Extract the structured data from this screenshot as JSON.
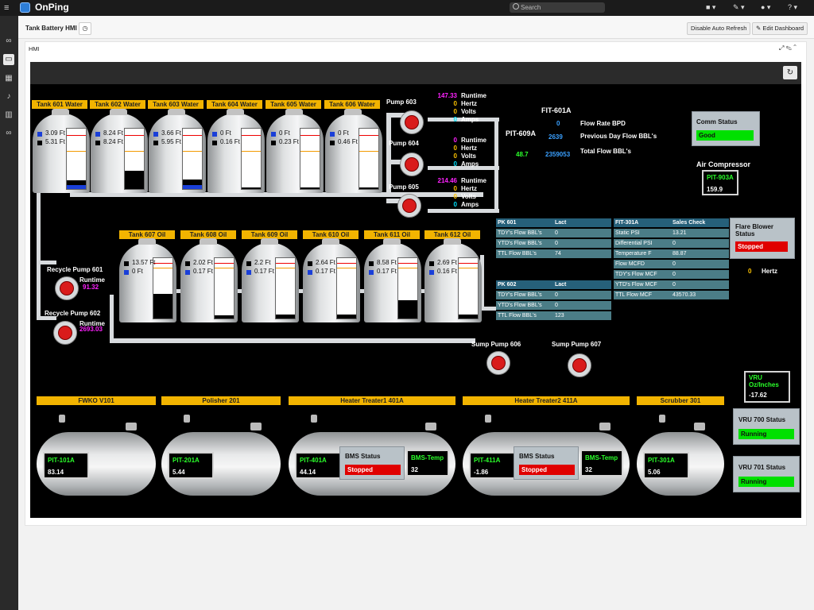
{
  "app": {
    "name": "OnPing"
  },
  "search": {
    "placeholder": "Search"
  },
  "dashboard": {
    "title": "Tank Battery HMI",
    "disable_refresh": "Disable Auto Refresh",
    "edit": "Edit Dashboard",
    "panel_title": "HMI"
  },
  "tanks_top": [
    {
      "name": "Tank 601 Water",
      "v1": "3.09 Ft",
      "v2": "5.31 Ft",
      "fill": 0.14,
      "blue": 0.07
    },
    {
      "name": "Tank 602 Water",
      "v1": "8.24 Ft",
      "v2": "8.24 Ft",
      "fill": 0.3,
      "blue": 0.0
    },
    {
      "name": "Tank 603 Water",
      "v1": "3.66 Ft",
      "v2": "5.95 Ft",
      "fill": 0.16,
      "blue": 0.06
    },
    {
      "name": "Tank 604 Water",
      "v1": "0 Ft",
      "v2": "0.16 Ft",
      "fill": 0.02,
      "blue": 0.0
    },
    {
      "name": "Tank 605 Water",
      "v1": "0 Ft",
      "v2": "0.23 Ft",
      "fill": 0.02,
      "blue": 0.0
    },
    {
      "name": "Tank 606 Water",
      "v1": "0 Ft",
      "v2": "0.46 Ft",
      "fill": 0.03,
      "blue": 0.0
    }
  ],
  "tanks_bottom": [
    {
      "name": "Tank 607 Oil",
      "v1": "13.57 Ft",
      "v2": "0 Ft",
      "fill": 0.4
    },
    {
      "name": "Tank 608 Oil",
      "v1": "2.02 Ft",
      "v2": "0.17 Ft",
      "fill": 0.05
    },
    {
      "name": "Tank 609 Oil",
      "v1": "2.2 Ft",
      "v2": "0.17 Ft",
      "fill": 0.06
    },
    {
      "name": "Tank 610 Oil",
      "v1": "2.64 Ft",
      "v2": "0.17 Ft",
      "fill": 0.06
    },
    {
      "name": "Tank 611 Oil",
      "v1": "8.58 Ft",
      "v2": "0.17 Ft",
      "fill": 0.3
    },
    {
      "name": "Tank 612 Oil",
      "v1": "2.69 Ft",
      "v2": "0.16 Ft",
      "fill": 0.07
    }
  ],
  "pumps": [
    {
      "name": "Pump 603",
      "runtime": "147.33",
      "hertz": "0",
      "volts": "0",
      "amps": "0"
    },
    {
      "name": "Pump 604",
      "runtime": "0",
      "hertz": "0",
      "volts": "0",
      "amps": "0"
    },
    {
      "name": "Pump 605",
      "runtime": "214.46",
      "hertz": "0",
      "volts": "0",
      "amps": "0"
    }
  ],
  "pump_labels": {
    "runtime": "Runtime",
    "hertz": "Hertz",
    "volts": "Volts",
    "amps": "Amps"
  },
  "recycle": [
    {
      "name": "Recycle Pump 601",
      "label": "Runtime",
      "value": "91.32"
    },
    {
      "name": "Recycle Pump 602",
      "label": "Runtime",
      "value": "2693.03"
    }
  ],
  "sump": [
    "Sump Pump 606",
    "Sump Pump 607"
  ],
  "fit601": {
    "title": "FIT-601A",
    "pit": "PIT-609A",
    "pit_value": "48.7",
    "rate_value": "0",
    "rate_label": "Flow Rate BPD",
    "prev_value": "2639",
    "prev_label": "Previous Day Flow BBL's",
    "total_value": "2359053",
    "total_label": "Total Flow BBL's"
  },
  "comm": {
    "title": "Comm Status",
    "value": "Good"
  },
  "air": {
    "title": "Air Compressor",
    "tag": "PIT-903A",
    "value": "159.9"
  },
  "flare": {
    "title": "Flare Blower Status",
    "value": "Stopped",
    "hz_value": "0",
    "hz_label": "Hertz"
  },
  "pk601": {
    "headers": [
      "PK 601",
      "Lact"
    ],
    "rows": [
      [
        "TDY's Flow BBL's",
        "0"
      ],
      [
        "YTD's Flow BBL's",
        "0"
      ],
      [
        "TTL Flow BBL's",
        "74"
      ]
    ]
  },
  "pk602": {
    "headers": [
      "PK 602",
      "Lact"
    ],
    "rows": [
      [
        "TDY's Flow BBL's",
        "0"
      ],
      [
        "YTD's Flow BBL's",
        "0"
      ],
      [
        "TTL Flow BBL's",
        "123"
      ]
    ]
  },
  "fit301": {
    "headers": [
      "FIT-301A",
      "Sales Check"
    ],
    "rows": [
      [
        "Static PSI",
        "13.21"
      ],
      [
        "Differential PSI",
        "0"
      ],
      [
        "Temperature F",
        "88.87"
      ],
      [
        "Flow MCFD",
        "0"
      ],
      [
        "TDY's Flow MCF",
        "0"
      ],
      [
        "YTD's Flow MCF",
        "0"
      ],
      [
        "TTL Flow MCF",
        "43570.33"
      ]
    ]
  },
  "vru": {
    "title": "VRU Oz/Inches",
    "value": "-17.62"
  },
  "vru700": {
    "title": "VRU 700 Status",
    "value": "Running"
  },
  "vru701": {
    "title": "VRU 701 Status",
    "value": "Running"
  },
  "vessels": [
    {
      "name": "FWKO V101",
      "tag": "PIT-101A",
      "value": "83.14"
    },
    {
      "name": "Polisher 201",
      "tag": "PIT-201A",
      "value": "5.44"
    },
    {
      "name": "Heater Treater1 401A",
      "tag": "PIT-401A",
      "value": "44.14",
      "bms": "BMS Status",
      "bms_value": "Stopped",
      "temp": "BMS-Temp",
      "temp_value": "32"
    },
    {
      "name": "Heater Treater2 411A",
      "tag": "PIT-411A",
      "value": "-1.86",
      "bms": "BMS Status",
      "bms_value": "Stopped",
      "temp": "BMS-Temp",
      "temp_value": "32"
    },
    {
      "name": "Scrubber 301",
      "tag": "PIT-301A",
      "value": "5.06"
    }
  ],
  "colors": {
    "runtime": "#ff22ff",
    "hertz": "#ffc400",
    "volts": "#ffc400",
    "amps": "#00e5ff",
    "green": "#2aff2a",
    "blue": "#3aa0ff"
  }
}
